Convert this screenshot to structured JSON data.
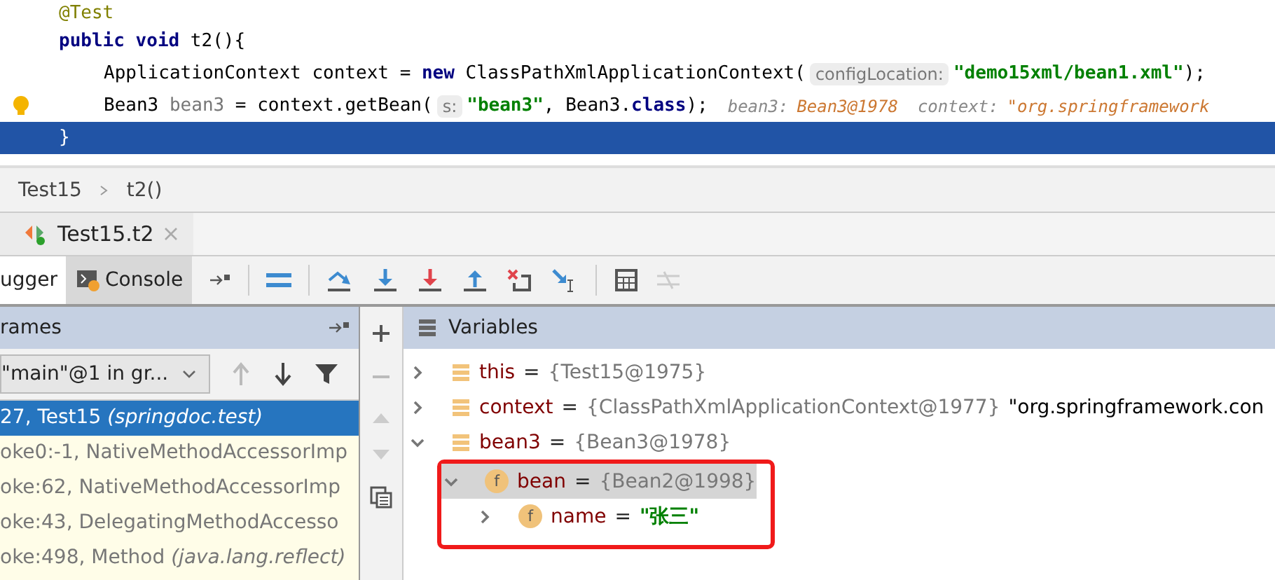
{
  "editor": {
    "lines": [
      {
        "indented": false,
        "bulb": false,
        "selected": false,
        "tokens": [
          {
            "kind": "annotation",
            "text": "@Test"
          }
        ]
      },
      {
        "indented": false,
        "bulb": false,
        "selected": false,
        "tokens": [
          {
            "kind": "keyword",
            "text": "public void "
          },
          {
            "kind": "plain",
            "text": "t2(){"
          }
        ]
      },
      {
        "indented": true,
        "bulb": false,
        "selected": false,
        "tokens": [
          {
            "kind": "plain",
            "text": "ApplicationContext context = "
          },
          {
            "kind": "keyword",
            "text": "new "
          },
          {
            "kind": "plain",
            "text": "ClassPathXmlApplicationContext("
          },
          {
            "kind": "hint",
            "text": "configLocation:"
          },
          {
            "kind": "string",
            "text": "\"demo15xml/bean1.xml\""
          },
          {
            "kind": "plain",
            "text": ");"
          }
        ]
      },
      {
        "indented": true,
        "bulb": true,
        "selected": false,
        "tokens": [
          {
            "kind": "plain",
            "text": "Bean3 "
          },
          {
            "kind": "muted",
            "text": "bean3"
          },
          {
            "kind": "plain",
            "text": " = context.getBean("
          },
          {
            "kind": "hint",
            "text": "s:"
          },
          {
            "kind": "string",
            "text": "\"bean3\""
          },
          {
            "kind": "plain",
            "text": ", Bean3."
          },
          {
            "kind": "keyword",
            "text": "class"
          },
          {
            "kind": "plain",
            "text": ");"
          },
          {
            "kind": "inline-name",
            "text": "bean3:"
          },
          {
            "kind": "inline-value",
            "text": "Bean3@1978"
          },
          {
            "kind": "inline-name",
            "text": "context:"
          },
          {
            "kind": "inline-value",
            "text": "\"org.springframework"
          }
        ]
      },
      {
        "indented": false,
        "bulb": false,
        "selected": true,
        "tokens": [
          {
            "kind": "plain",
            "text": "}"
          }
        ]
      }
    ]
  },
  "breadcrumbs": [
    "Test15",
    "t2()"
  ],
  "session_tab": {
    "label": "Test15.t2"
  },
  "tool_tabs": [
    {
      "label": "ugger",
      "selected": true
    },
    {
      "label": "Console",
      "selected": false
    }
  ],
  "frames": {
    "title": "rames",
    "thread": "\"main\"@1 in gr...",
    "items": [
      {
        "text": "27, Test15 *(springdoc.test)*",
        "selected": true
      },
      {
        "text": "oke0:-1, NativeMethodAccessorImp",
        "selected": false
      },
      {
        "text": "oke:62, NativeMethodAccessorImp",
        "selected": false
      },
      {
        "text": "oke:43, DelegatingMethodAccesso",
        "selected": false
      },
      {
        "text": "oke:498, Method *(java.lang.reflect)*",
        "selected": false
      }
    ]
  },
  "variables": {
    "title": "Variables",
    "items": [
      {
        "kind": "local",
        "name": "this",
        "operator": "=",
        "value": "{Test15@1975}",
        "expanded": false,
        "selected": false,
        "highlighted": false
      },
      {
        "kind": "local",
        "name": "context",
        "operator": "=",
        "value": "{ClassPathXmlApplicationContext@1977}",
        "extra": "\"org.springframework.con",
        "expanded": false,
        "selected": false,
        "highlighted": false
      },
      {
        "kind": "local",
        "name": "bean3",
        "operator": "=",
        "value": "{Bean3@1978}",
        "expanded": true,
        "selected": false,
        "highlighted": false,
        "children": [
          {
            "kind": "field",
            "badge": "f",
            "name": "bean",
            "operator": "=",
            "value": "{Bean2@1998}",
            "expanded": true,
            "selected": true,
            "highlighted": true,
            "children": [
              {
                "kind": "field",
                "badge": "f",
                "name": "name",
                "operator": "=",
                "string": "\"张三\"",
                "expanded": false,
                "selected": false,
                "highlighted": false
              }
            ]
          }
        ]
      }
    ]
  }
}
